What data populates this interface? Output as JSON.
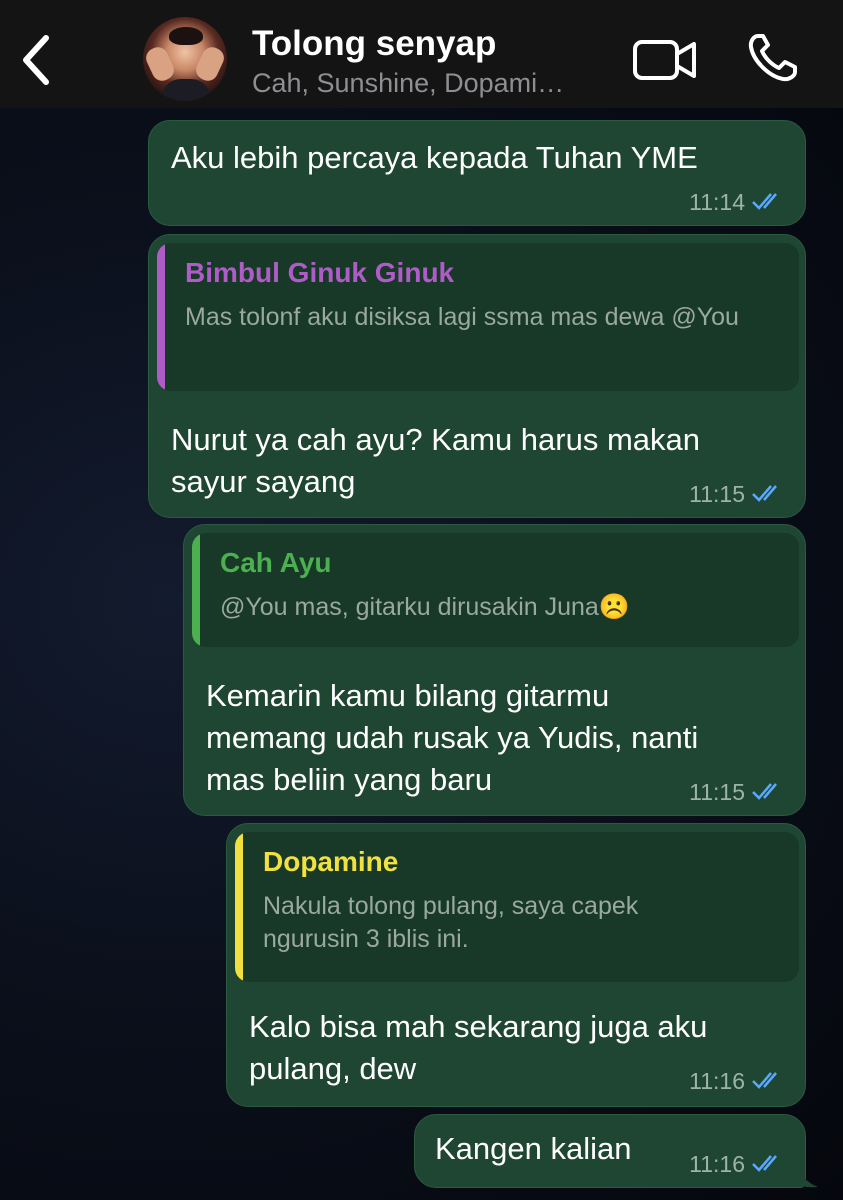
{
  "header": {
    "title": "Tolong senyap",
    "subtitle": "Cah, Sunshine, Dopami…"
  },
  "messages": [
    {
      "text": "Aku lebih percaya kepada Tuhan YME",
      "time": "11:14"
    },
    {
      "quote": {
        "author": "Bimbul Ginuk Ginuk",
        "author_color": "#b05cc8",
        "text": "Mas tolonf aku disiksa lagi ssma mas dewa @You"
      },
      "text_lines": [
        "Nurut ya cah ayu? Kamu harus makan",
        "sayur sayang"
      ],
      "time": "11:15"
    },
    {
      "quote": {
        "author": "Cah Ayu",
        "author_color": "#4caf50",
        "text": "@You mas, gitarku dirusakin Juna☹️"
      },
      "text_lines": [
        "Kemarin kamu bilang gitarmu",
        "memang udah rusak ya Yudis, nanti",
        "mas beliin yang baru"
      ],
      "time": "11:15"
    },
    {
      "quote": {
        "author": "Dopamine",
        "author_color": "#f0e040",
        "text_lines": [
          "Nakula tolong pulang, saya capek",
          "ngurusin 3 iblis ini."
        ]
      },
      "text_lines": [
        "Kalo bisa mah sekarang juga aku",
        "pulang, dew"
      ],
      "time": "11:16"
    },
    {
      "text": "Kangen kalian",
      "time": "11:16"
    }
  ],
  "colors": {
    "bubble": "#1f4632",
    "read_ticks": "#5aa8ff",
    "header_bg": "#141414"
  },
  "icons": [
    "back-chevron-icon",
    "video-camera-icon",
    "phone-icon",
    "double-check-icon"
  ]
}
